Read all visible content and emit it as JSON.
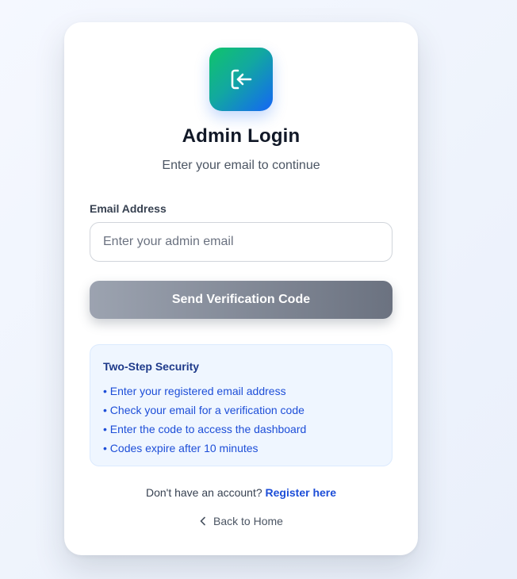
{
  "header": {
    "logo_icon": "login-arrow-icon",
    "title": "Admin Login",
    "subtitle": "Enter your email to continue"
  },
  "form": {
    "email_label": "Email Address",
    "email_value": "",
    "email_placeholder": "Enter your admin email",
    "submit_label": "Send Verification Code"
  },
  "info": {
    "title": "Two-Step Security",
    "items": [
      "• Enter your registered email address",
      "• Check your email for a verification code",
      "• Enter the code to access the dashboard",
      "• Codes expire after 10 minutes"
    ]
  },
  "footer": {
    "register_prompt": "Don't have an account?",
    "register_link": "Register here",
    "back_icon": "chevron-left-icon",
    "back_label": "Back to Home"
  },
  "colors": {
    "logo_gradient_start": "#10c46a",
    "logo_gradient_end": "#1466f5",
    "button_gradient_start": "#9ca3b0",
    "button_gradient_end": "#6b7280",
    "info_background": "#eff6ff",
    "link": "#1d4ed8"
  }
}
